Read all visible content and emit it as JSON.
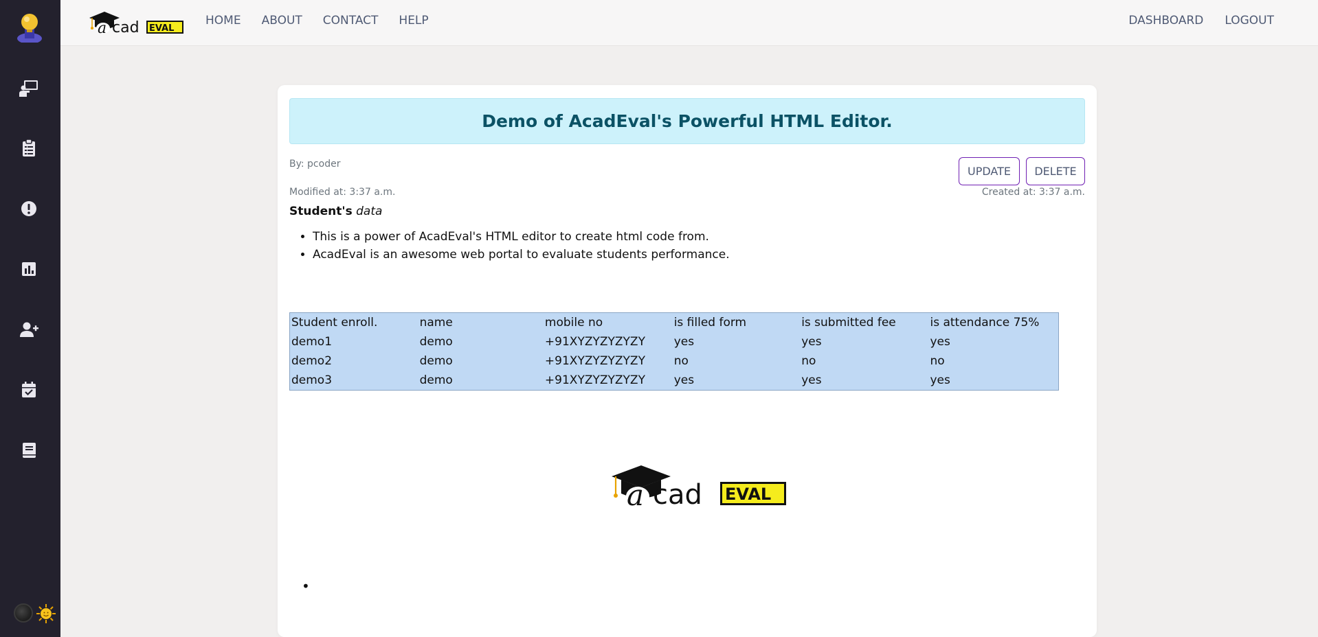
{
  "brand": {
    "logo_text_a": "a",
    "logo_text_cad": "cad",
    "logo_text_eval": "EVAL"
  },
  "nav": {
    "left": [
      "HOME",
      "ABOUT",
      "CONTACT",
      "HELP"
    ],
    "right": [
      "DASHBOARD",
      "LOGOUT"
    ]
  },
  "sidebar": {
    "items": [
      {
        "icon": "teacher-board-icon"
      },
      {
        "icon": "clipboard-icon"
      },
      {
        "icon": "alert-circle-icon"
      },
      {
        "icon": "bar-chart-icon"
      },
      {
        "icon": "add-user-icon"
      },
      {
        "icon": "calendar-check-icon"
      },
      {
        "icon": "book-icon"
      }
    ]
  },
  "post": {
    "title": "Demo of AcadEval's Powerful HTML Editor.",
    "author": "By: pcoder",
    "modified": "Modified at: 3:37 a.m.",
    "created": "Created at: 3:37 a.m.",
    "update_label": "UPDATE",
    "delete_label": "DELETE",
    "heading_bold": "Student's",
    "heading_italic": "data",
    "bullets": [
      "This is a power of AcadEval's HTML editor to create html code from.",
      "AcadEval is an awesome web portal to evaluate students performance."
    ],
    "table": {
      "headers": [
        "Student enroll.",
        "name",
        "mobile no",
        "is filled form",
        "is submitted fee",
        "is attendance 75%"
      ],
      "rows": [
        [
          "demo1",
          "demo",
          "+91XYZYZYZYZY",
          "yes",
          "yes",
          "yes"
        ],
        [
          "demo2",
          "demo",
          "+91XYZYZYZYZY",
          "no",
          "no",
          "no"
        ],
        [
          "demo3",
          "demo",
          "+91XYZYZYZYZY",
          "yes",
          "yes",
          "yes"
        ]
      ]
    }
  },
  "colors": {
    "sidebar_bg": "#23212d",
    "accent": "#6f1fb3",
    "title_bg": "#cdf2fb",
    "title_text": "#0b5265",
    "table_bg": "#c0d9f4"
  }
}
